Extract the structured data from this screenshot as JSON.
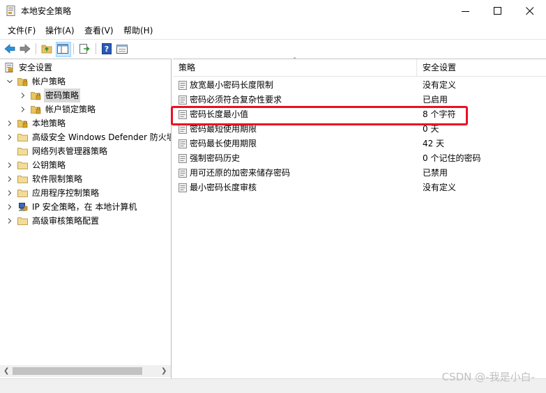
{
  "window": {
    "title": "本地安全策略"
  },
  "menu": [
    "文件(F)",
    "操作(A)",
    "查看(V)",
    "帮助(H)"
  ],
  "toolbar": {
    "buttons": [
      "back-icon",
      "forward-icon",
      "up-folder-icon",
      "show-tree-icon",
      "export-list-icon",
      "help-icon",
      "properties-icon"
    ]
  },
  "tree": {
    "root": "安全设置",
    "items": [
      {
        "label": "帐户策略",
        "expanded": true,
        "indent": 1
      },
      {
        "label": "密码策略",
        "selected": true,
        "indent": 2
      },
      {
        "label": "帐户锁定策略",
        "indent": 2
      },
      {
        "label": "本地策略",
        "indent": 1
      },
      {
        "label": "高级安全 Windows Defender 防火墙",
        "indent": 1
      },
      {
        "label": "网络列表管理器策略",
        "indent": 1
      },
      {
        "label": "公钥策略",
        "indent": 1
      },
      {
        "label": "软件限制策略",
        "indent": 1
      },
      {
        "label": "应用程序控制策略",
        "indent": 1
      },
      {
        "label": "IP 安全策略，在 本地计算机",
        "indent": 1
      },
      {
        "label": "高级审核策略配置",
        "indent": 1
      }
    ]
  },
  "columns": {
    "policy": "策略",
    "setting": "安全设置"
  },
  "policies": [
    {
      "name": "放宽最小密码长度限制",
      "value": "没有定义"
    },
    {
      "name": "密码必须符合复杂性要求",
      "value": "已启用"
    },
    {
      "name": "密码长度最小值",
      "value": "8 个字符",
      "highlighted": true
    },
    {
      "name": "密码最短使用期限",
      "value": "0 天"
    },
    {
      "name": "密码最长使用期限",
      "value": "42 天"
    },
    {
      "name": "强制密码历史",
      "value": "0 个记住的密码"
    },
    {
      "name": "用可还原的加密来储存密码",
      "value": "已禁用"
    },
    {
      "name": "最小密码长度审核",
      "value": "没有定义"
    }
  ],
  "watermark": "CSDN @-我是小白-",
  "colors": {
    "highlight": "#e81123",
    "folder": "#e8c465",
    "nav_arrow": "#1e90ff",
    "selection": "#d9d9d9"
  }
}
